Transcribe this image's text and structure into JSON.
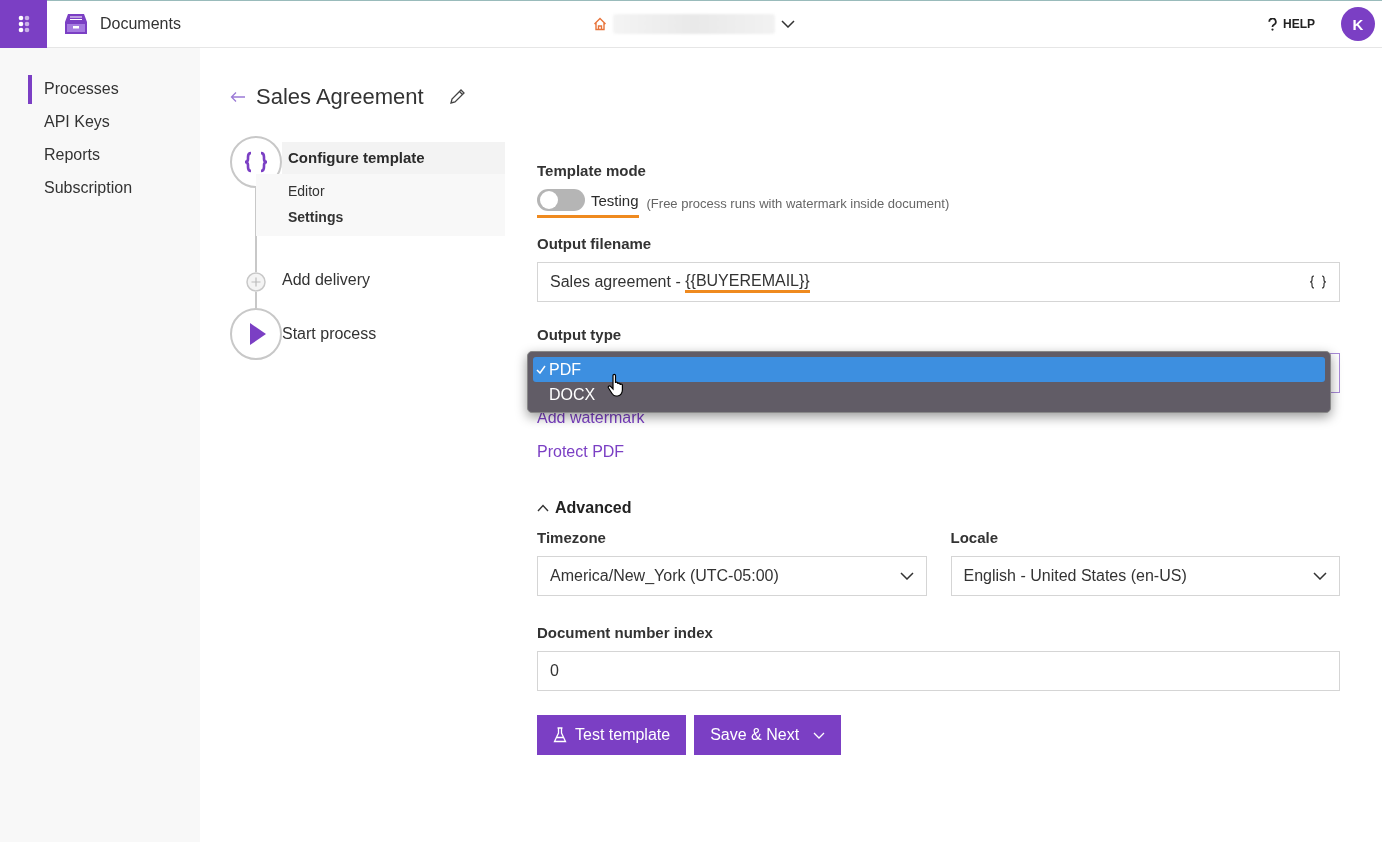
{
  "app": {
    "name": "Documents"
  },
  "header": {
    "help": "HELP",
    "avatar": "K"
  },
  "sidebar": {
    "items": [
      {
        "label": "Processes",
        "selected": true
      },
      {
        "label": "API Keys",
        "selected": false
      },
      {
        "label": "Reports",
        "selected": false
      },
      {
        "label": "Subscription",
        "selected": false
      }
    ]
  },
  "page": {
    "title": "Sales Agreement"
  },
  "steps": [
    {
      "kind": "template",
      "label": "Configure template",
      "children": [
        {
          "label": "Editor",
          "selected": false
        },
        {
          "label": "Settings",
          "selected": true
        }
      ]
    },
    {
      "kind": "add",
      "label": "Add delivery"
    },
    {
      "kind": "start",
      "label": "Start process"
    }
  ],
  "form": {
    "template_mode": {
      "label": "Template mode",
      "on": false,
      "highlighted": true,
      "state": "Testing",
      "note": "(Free process runs with watermark inside document)"
    },
    "output_filename": {
      "label": "Output filename",
      "value": [
        {
          "text": "Sales agreement - ",
          "highlighted": false
        },
        {
          "text": "{{BUYEREMAIL}}",
          "highlighted": true
        }
      ]
    },
    "output_type": {
      "label": "Output type",
      "expanded": true,
      "options": [
        {
          "label": "PDF",
          "selected": true
        },
        {
          "label": "DOCX",
          "selected": false
        }
      ]
    },
    "links": [
      "Add watermark",
      "Protect PDF"
    ],
    "advanced": {
      "label": "Advanced",
      "expanded": true,
      "timezone": {
        "label": "Timezone",
        "value": "America/New_York (UTC-05:00)"
      },
      "locale": {
        "label": "Locale",
        "value": "English - United States (en-US)"
      }
    },
    "document_number_index": {
      "label": "Document number index",
      "value": "0"
    },
    "buttons": [
      {
        "kind": "test",
        "label": "Test template"
      },
      {
        "kind": "split",
        "label": "Save & Next"
      }
    ]
  }
}
